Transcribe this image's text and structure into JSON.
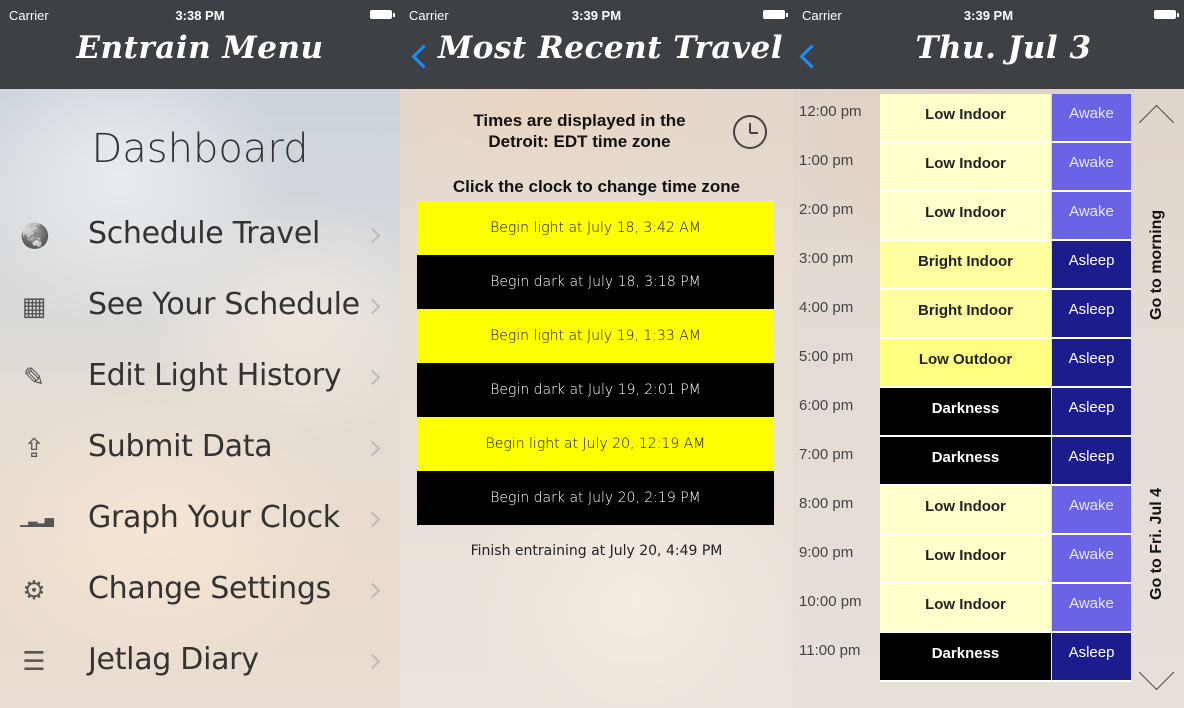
{
  "status_bars": [
    {
      "carrier": "Carrier",
      "time": "3:38 PM"
    },
    {
      "carrier": "Carrier",
      "time": "3:39 PM"
    },
    {
      "carrier": "Carrier",
      "time": "3:39 PM"
    }
  ],
  "menu_screen": {
    "title": "Entrain Menu",
    "dashboard": "Dashboard",
    "items": [
      {
        "label": "Schedule Travel",
        "icon": "globe-icon"
      },
      {
        "label": "See Your Schedule",
        "icon": "calendar-icon"
      },
      {
        "label": "Edit Light History",
        "icon": "edit-icon"
      },
      {
        "label": "Submit Data",
        "icon": "share-icon"
      },
      {
        "label": "Graph Your Clock",
        "icon": "bar-graph-icon"
      },
      {
        "label": "Change Settings",
        "icon": "gear-icon"
      },
      {
        "label": "Jetlag Diary",
        "icon": "list-icon"
      }
    ]
  },
  "travel_screen": {
    "title": "Most Recent Travel",
    "timezone_text_1": "Times are displayed in the",
    "timezone_text_2": "Detroit: EDT time zone",
    "click_text": "Click the clock to change time zone",
    "events": [
      {
        "type": "light",
        "text": "Begin light at July 18, 3:42 AM"
      },
      {
        "type": "dark",
        "text": "Begin dark at July 18, 3:18 PM"
      },
      {
        "type": "light",
        "text": "Begin light at July 19, 1:33 AM"
      },
      {
        "type": "dark",
        "text": "Begin dark at July 19, 2:01 PM"
      },
      {
        "type": "light",
        "text": "Begin light at July 20, 12:19 AM"
      },
      {
        "type": "dark",
        "text": "Begin dark at July 20, 2:19 PM"
      }
    ],
    "finish": "Finish entraining at July 20, 4:49 PM"
  },
  "day_screen": {
    "title": "Thu. Jul 3",
    "go_morning": "Go to morning",
    "go_next": "Go to Fri. Jul 4",
    "rows": [
      {
        "hour": "12:00 pm",
        "light": "Low Indoor",
        "light_class": "low-indoor",
        "sleep": "Awake"
      },
      {
        "hour": "1:00 pm",
        "light": "Low Indoor",
        "light_class": "low-indoor",
        "sleep": "Awake"
      },
      {
        "hour": "2:00 pm",
        "light": "Low Indoor",
        "light_class": "low-indoor",
        "sleep": "Awake"
      },
      {
        "hour": "3:00 pm",
        "light": "Bright Indoor",
        "light_class": "bright-indoor",
        "sleep": "Asleep"
      },
      {
        "hour": "4:00 pm",
        "light": "Bright Indoor",
        "light_class": "bright-indoor",
        "sleep": "Asleep"
      },
      {
        "hour": "5:00 pm",
        "light": "Low Outdoor",
        "light_class": "low-outdoor",
        "sleep": "Asleep"
      },
      {
        "hour": "6:00 pm",
        "light": "Darkness",
        "light_class": "darkness",
        "sleep": "Asleep"
      },
      {
        "hour": "7:00 pm",
        "light": "Darkness",
        "light_class": "darkness",
        "sleep": "Asleep"
      },
      {
        "hour": "8:00 pm",
        "light": "Low Indoor",
        "light_class": "low-indoor",
        "sleep": "Awake"
      },
      {
        "hour": "9:00 pm",
        "light": "Low Indoor",
        "light_class": "low-indoor",
        "sleep": "Awake"
      },
      {
        "hour": "10:00 pm",
        "light": "Low Indoor",
        "light_class": "low-indoor",
        "sleep": "Awake"
      },
      {
        "hour": "11:00 pm",
        "light": "Darkness",
        "light_class": "darkness",
        "sleep": "Asleep"
      }
    ]
  },
  "colors": {
    "navbar": "#3d4145",
    "back_chevron": "#1a8cff",
    "light_event": "#ffff00",
    "dark_event": "#000000",
    "awake": "#6a63e6",
    "asleep": "#1c1c8c"
  }
}
